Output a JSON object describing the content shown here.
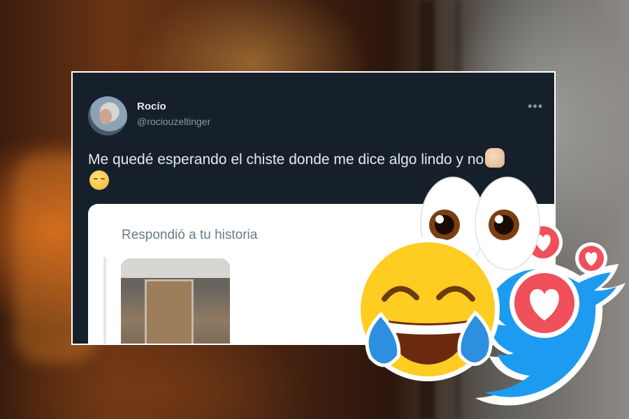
{
  "tweet": {
    "author_name": "Rocío",
    "author_handle": "@rociouzeltinger",
    "more_icon": "more-options-icon",
    "text": "Me quedé esperando el chiste donde me dice algo lindo y no",
    "emojis": [
      "raised-fist-emoji",
      "relieved-face-emoji"
    ]
  },
  "reply_card": {
    "label": "Respondió a tu historia"
  },
  "overlay": {
    "stickers": [
      "eyes-emoji",
      "tears-of-joy-emoji",
      "heart-reaction-icon",
      "twitter-bird-logo"
    ],
    "colors": {
      "twitter_blue": "#1d9bf0",
      "heart_red": "#f0505a",
      "emoji_yellow": "#ffcc22"
    }
  }
}
